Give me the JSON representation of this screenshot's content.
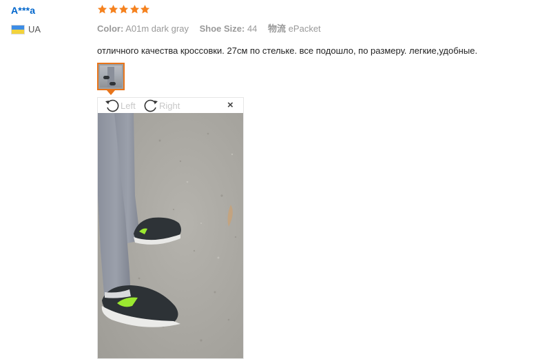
{
  "review": {
    "user": {
      "name": "A***a",
      "country_code": "UA",
      "flag_colors": [
        "#3d8de6",
        "#f2d33c"
      ]
    },
    "rating": {
      "stars": 5,
      "max": 5,
      "color": "#f5821f"
    },
    "attributes": [
      {
        "key": "Color:",
        "value": "A01m dark gray"
      },
      {
        "key": "Shoe Size:",
        "value": "44"
      },
      {
        "key": "物流",
        "value": "ePacket"
      }
    ],
    "text": "отличного качества кроссовки. 27см по стельке. все подошло, по размеру. легкие,удобные.",
    "thumbnail": {
      "selected": true,
      "accent": "#e8741a"
    }
  },
  "viewer": {
    "rotate_left_label": "Left",
    "rotate_right_label": "Right",
    "close_label": "×"
  }
}
